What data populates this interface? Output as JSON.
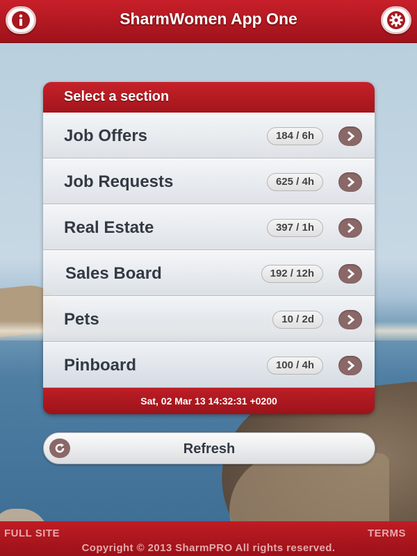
{
  "header": {
    "title": "SharmWomen App One",
    "left_icon": "info-icon",
    "right_icon": "gear-icon"
  },
  "panel": {
    "title": "Select a section",
    "rows": [
      {
        "label": "Job Offers",
        "count": "184 / 6h"
      },
      {
        "label": "Job Requests",
        "count": "625 / 4h"
      },
      {
        "label": "Real Estate",
        "count": "397 / 1h"
      },
      {
        "label": "Sales Board",
        "count": "192 / 12h"
      },
      {
        "label": "Pets",
        "count": "10 / 2d"
      },
      {
        "label": "Pinboard",
        "count": "100 / 4h"
      }
    ],
    "timestamp": "Sat, 02 Mar 13 14:32:31 +0200"
  },
  "refresh": {
    "label": "Refresh",
    "icon": "refresh-icon"
  },
  "footer": {
    "full_site": "FULL SITE",
    "terms": "TERMS",
    "copyright": "Copyright © 2013 SharmPRO All rights reserved."
  },
  "colors": {
    "brand_red": "#b01820",
    "arrow_button": "#8b6868",
    "row_text": "#333a44"
  }
}
